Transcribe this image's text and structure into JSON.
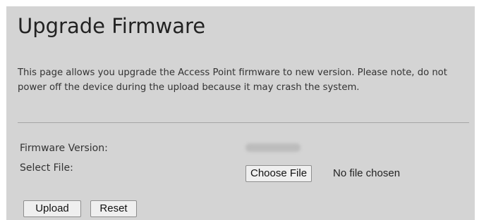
{
  "page": {
    "title": "Upgrade Firmware",
    "description": "This page allows you upgrade the Access Point firmware to new version. Please note, do not power off the device during the upload because it may crash the system."
  },
  "form": {
    "firmware_version_label": "Firmware Version:",
    "select_file_label": "Select File:",
    "choose_file_button": "Choose File",
    "file_status": "No file chosen"
  },
  "actions": {
    "upload_label": "Upload",
    "reset_label": "Reset"
  }
}
